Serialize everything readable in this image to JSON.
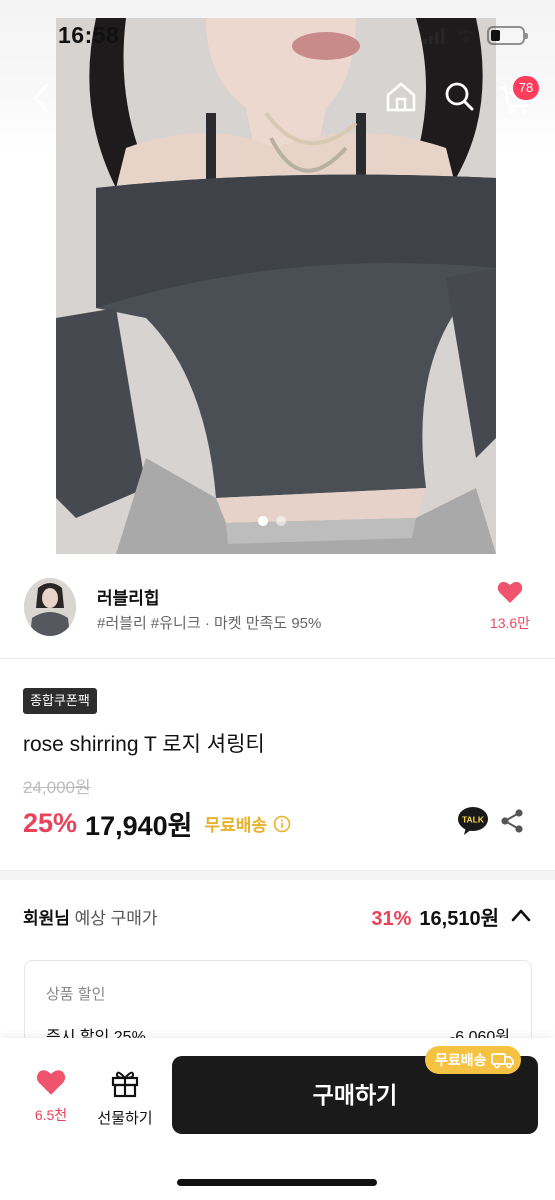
{
  "status": {
    "time": "16:58",
    "battery_level": 0.3
  },
  "nav": {
    "cart_count": "78"
  },
  "gallery": {
    "image_count": 2,
    "active_index": 0
  },
  "seller": {
    "name": "러블리힙",
    "meta": "#러블리 #유니크 · 마켓 만족도 95%",
    "like_count": "13.6만"
  },
  "product": {
    "coupon_badge": "종합쿠폰팩",
    "title": "rose shirring T 로지 셔링티",
    "original_price": "24,000원",
    "discount": "25%",
    "price": "17,940원",
    "free_shipping": "무료배송",
    "talk_label": "TALK"
  },
  "member": {
    "label_bold": "회원님",
    "label_rest": " 예상 구매가",
    "discount": "31%",
    "price": "16,510원",
    "detail_title": "상품 할인",
    "instant_label": "즉시 할인 25%",
    "instant_value": "-6,060원"
  },
  "bottom_bar": {
    "like_count": "6.5천",
    "gift_label": "선물하기",
    "buy_label": "구매하기",
    "ship_tag": "무료배송"
  },
  "colors": {
    "accent_red": "#e8435a",
    "badge_red": "#ff3e5d",
    "shipping_yellow": "#e9b12a",
    "button_dark": "#1a1a1a"
  },
  "icons": [
    "back-icon",
    "home-icon",
    "search-icon",
    "cart-icon",
    "heart-icon",
    "info-icon",
    "kakao-talk-icon",
    "share-icon",
    "chevron-up-icon",
    "gift-icon",
    "truck-icon"
  ]
}
